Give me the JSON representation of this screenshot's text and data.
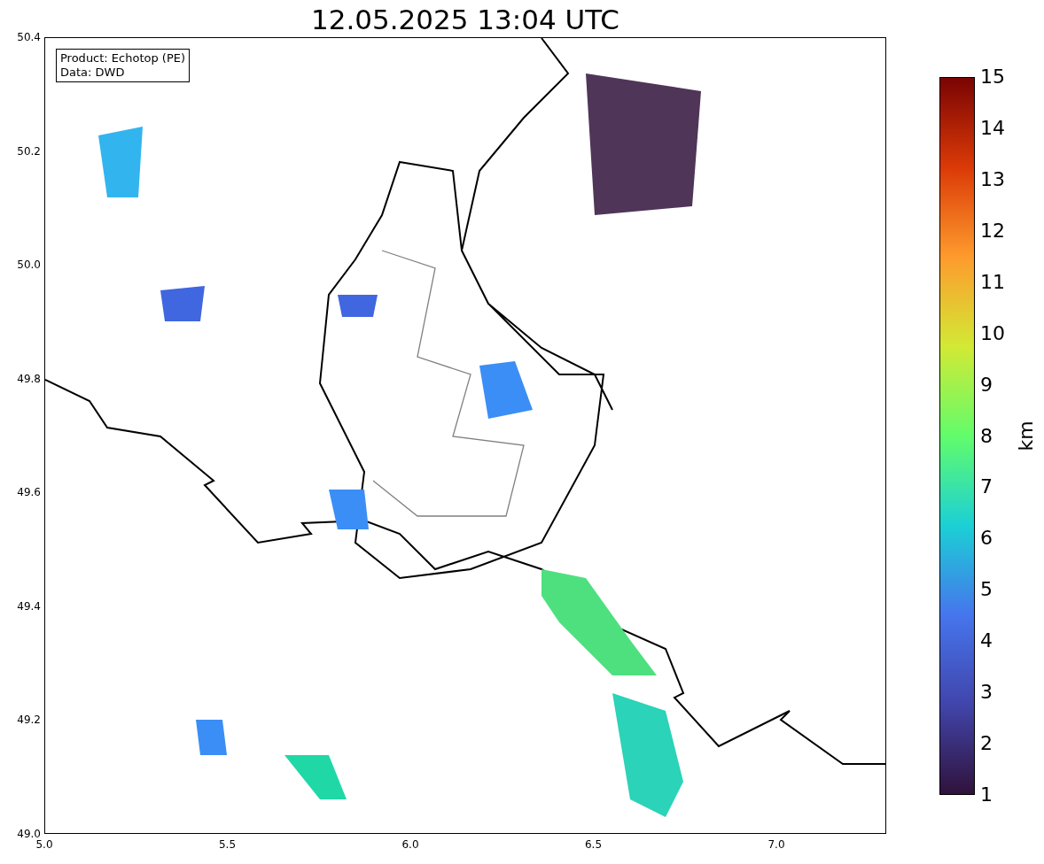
{
  "title": "12.05.2025 13:04 UTC",
  "legend": [
    "Product: Echotop (PE)",
    "Data: DWD"
  ],
  "x_ticks": [
    "5.0",
    "5.5",
    "6.0",
    "6.5",
    "7.0"
  ],
  "y_ticks": [
    "50.4",
    "50.2",
    "50.0",
    "49.8",
    "49.6",
    "49.4",
    "49.2",
    "49.0"
  ],
  "colorbar": {
    "label": "km",
    "ticks": [
      "15",
      "14",
      "13",
      "12",
      "11",
      "10",
      "9",
      "8",
      "7",
      "6",
      "5",
      "4",
      "3",
      "2",
      "1"
    ]
  }
}
